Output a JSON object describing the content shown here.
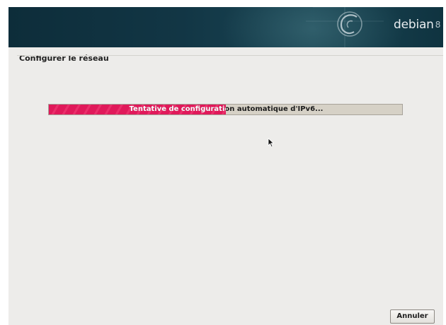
{
  "banner": {
    "brand": "debian",
    "version": "8"
  },
  "page": {
    "title": "Configurer le réseau"
  },
  "progress": {
    "label": "Tentative de configuration automatique d'IPv6...",
    "fraction": 0.5,
    "fill_color": "#e0195a"
  },
  "buttons": {
    "cancel": "Annuler"
  }
}
